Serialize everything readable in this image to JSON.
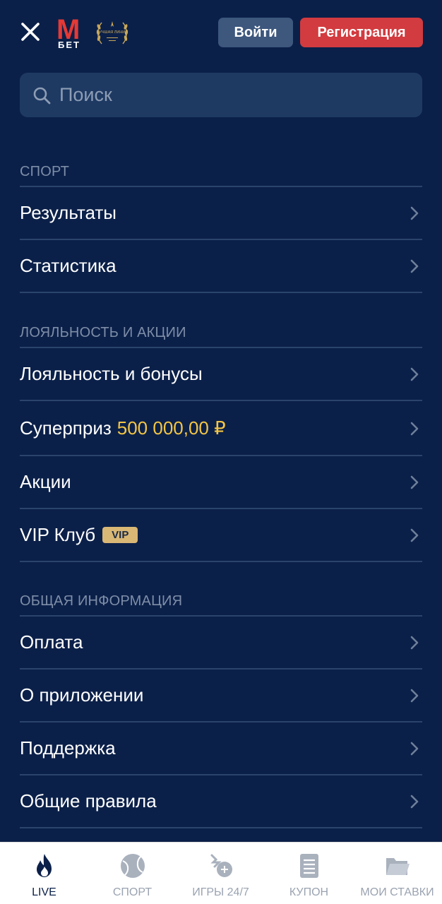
{
  "header": {
    "logo_letter": "М",
    "logo_sub": "БЕТ",
    "badge_text": "ЛУЧШАЯ ЛИНИЯ",
    "login_label": "Войти",
    "register_label": "Регистрация"
  },
  "search": {
    "placeholder": "Поиск"
  },
  "sections": {
    "sport": {
      "title": "СПОРТ",
      "items": [
        {
          "label": "Результаты"
        },
        {
          "label": "Статистика"
        }
      ]
    },
    "loyalty": {
      "title": "ЛОЯЛЬНОСТЬ И АКЦИИ",
      "items": [
        {
          "label": "Лояльность и бонусы"
        },
        {
          "label": "Суперприз",
          "amount": "500 000,00 ₽"
        },
        {
          "label": "Акции"
        },
        {
          "label": "VIP Клуб",
          "badge": "VIP"
        }
      ]
    },
    "info": {
      "title": "ОБЩАЯ ИНФОРМАЦИЯ",
      "items": [
        {
          "label": "Оплата"
        },
        {
          "label": "О приложении"
        },
        {
          "label": "Поддержка"
        },
        {
          "label": "Общие правила"
        }
      ]
    }
  },
  "tabbar": {
    "tabs": [
      {
        "label": "LIVE",
        "icon": "flame-icon",
        "active": true
      },
      {
        "label": "СПОРТ",
        "icon": "ball-icon",
        "active": false
      },
      {
        "label": "ИГРЫ 24/7",
        "icon": "games-icon",
        "active": false
      },
      {
        "label": "КУПОН",
        "icon": "coupon-icon",
        "active": false
      },
      {
        "label": "МОИ СТАВКИ",
        "icon": "folder-icon",
        "active": false
      }
    ]
  },
  "colors": {
    "background": "#0b2049",
    "accent_red": "#d23b3f",
    "amount_gold": "#f3c545",
    "vip_badge": "#d9b775"
  }
}
